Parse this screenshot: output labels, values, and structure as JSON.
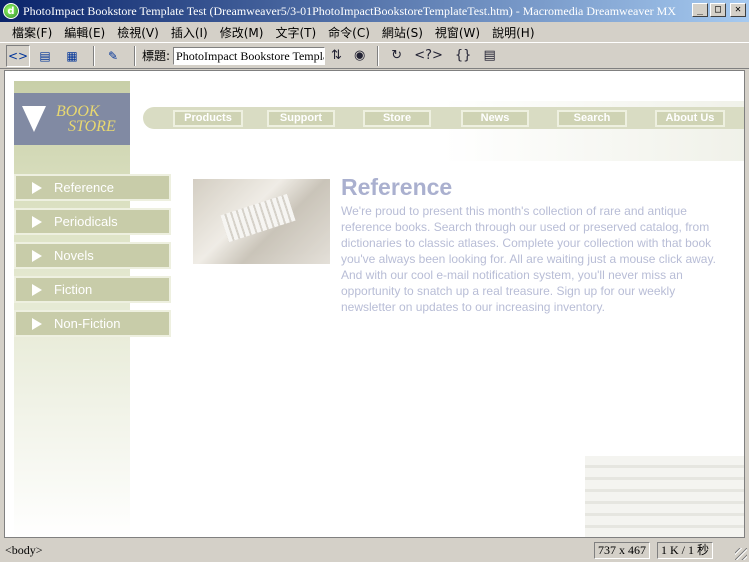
{
  "window": {
    "app_icon": "dreamweaver-icon",
    "title": "PhotoImpact Bookstore Template Test (Dreamweaver5/3-01PhotoImpactBookstoreTemplateTest.htm) - Macromedia Dreamweaver MX",
    "minimize": "_",
    "maximize": "□",
    "close": "✕"
  },
  "menu": [
    "檔案(F)",
    "編輯(E)",
    "檢視(V)",
    "插入(I)",
    "修改(M)",
    "文字(T)",
    "命令(C)",
    "網站(S)",
    "視窗(W)",
    "說明(H)"
  ],
  "toolbar": {
    "title_label": "標題:",
    "title_value": "PhotoImpact Bookstore Templa"
  },
  "page": {
    "logo_line1": "BOOK",
    "logo_line2": "STORE",
    "nav": [
      "Products",
      "Support",
      "Store",
      "News",
      "Search",
      "About Us"
    ],
    "side": [
      "Reference",
      "Periodicals",
      "Novels",
      "Fiction",
      "Non-Fiction"
    ],
    "heading": "Reference",
    "body": "We're proud to present this month's collection of rare and antique reference books. Search through our used or preserved catalog, from dictionaries to classic atlases. Complete your collection with that book you've always been looking for. All are waiting just a mouse click away. And with our cool e-mail notification system, you'll never miss an opportunity to snatch up a real treasure. Sign up for our weekly newsletter on updates to our increasing inventory."
  },
  "status": {
    "tag": "<body>",
    "size": "737 x 467",
    "kb": "1 K / 1 秒"
  }
}
